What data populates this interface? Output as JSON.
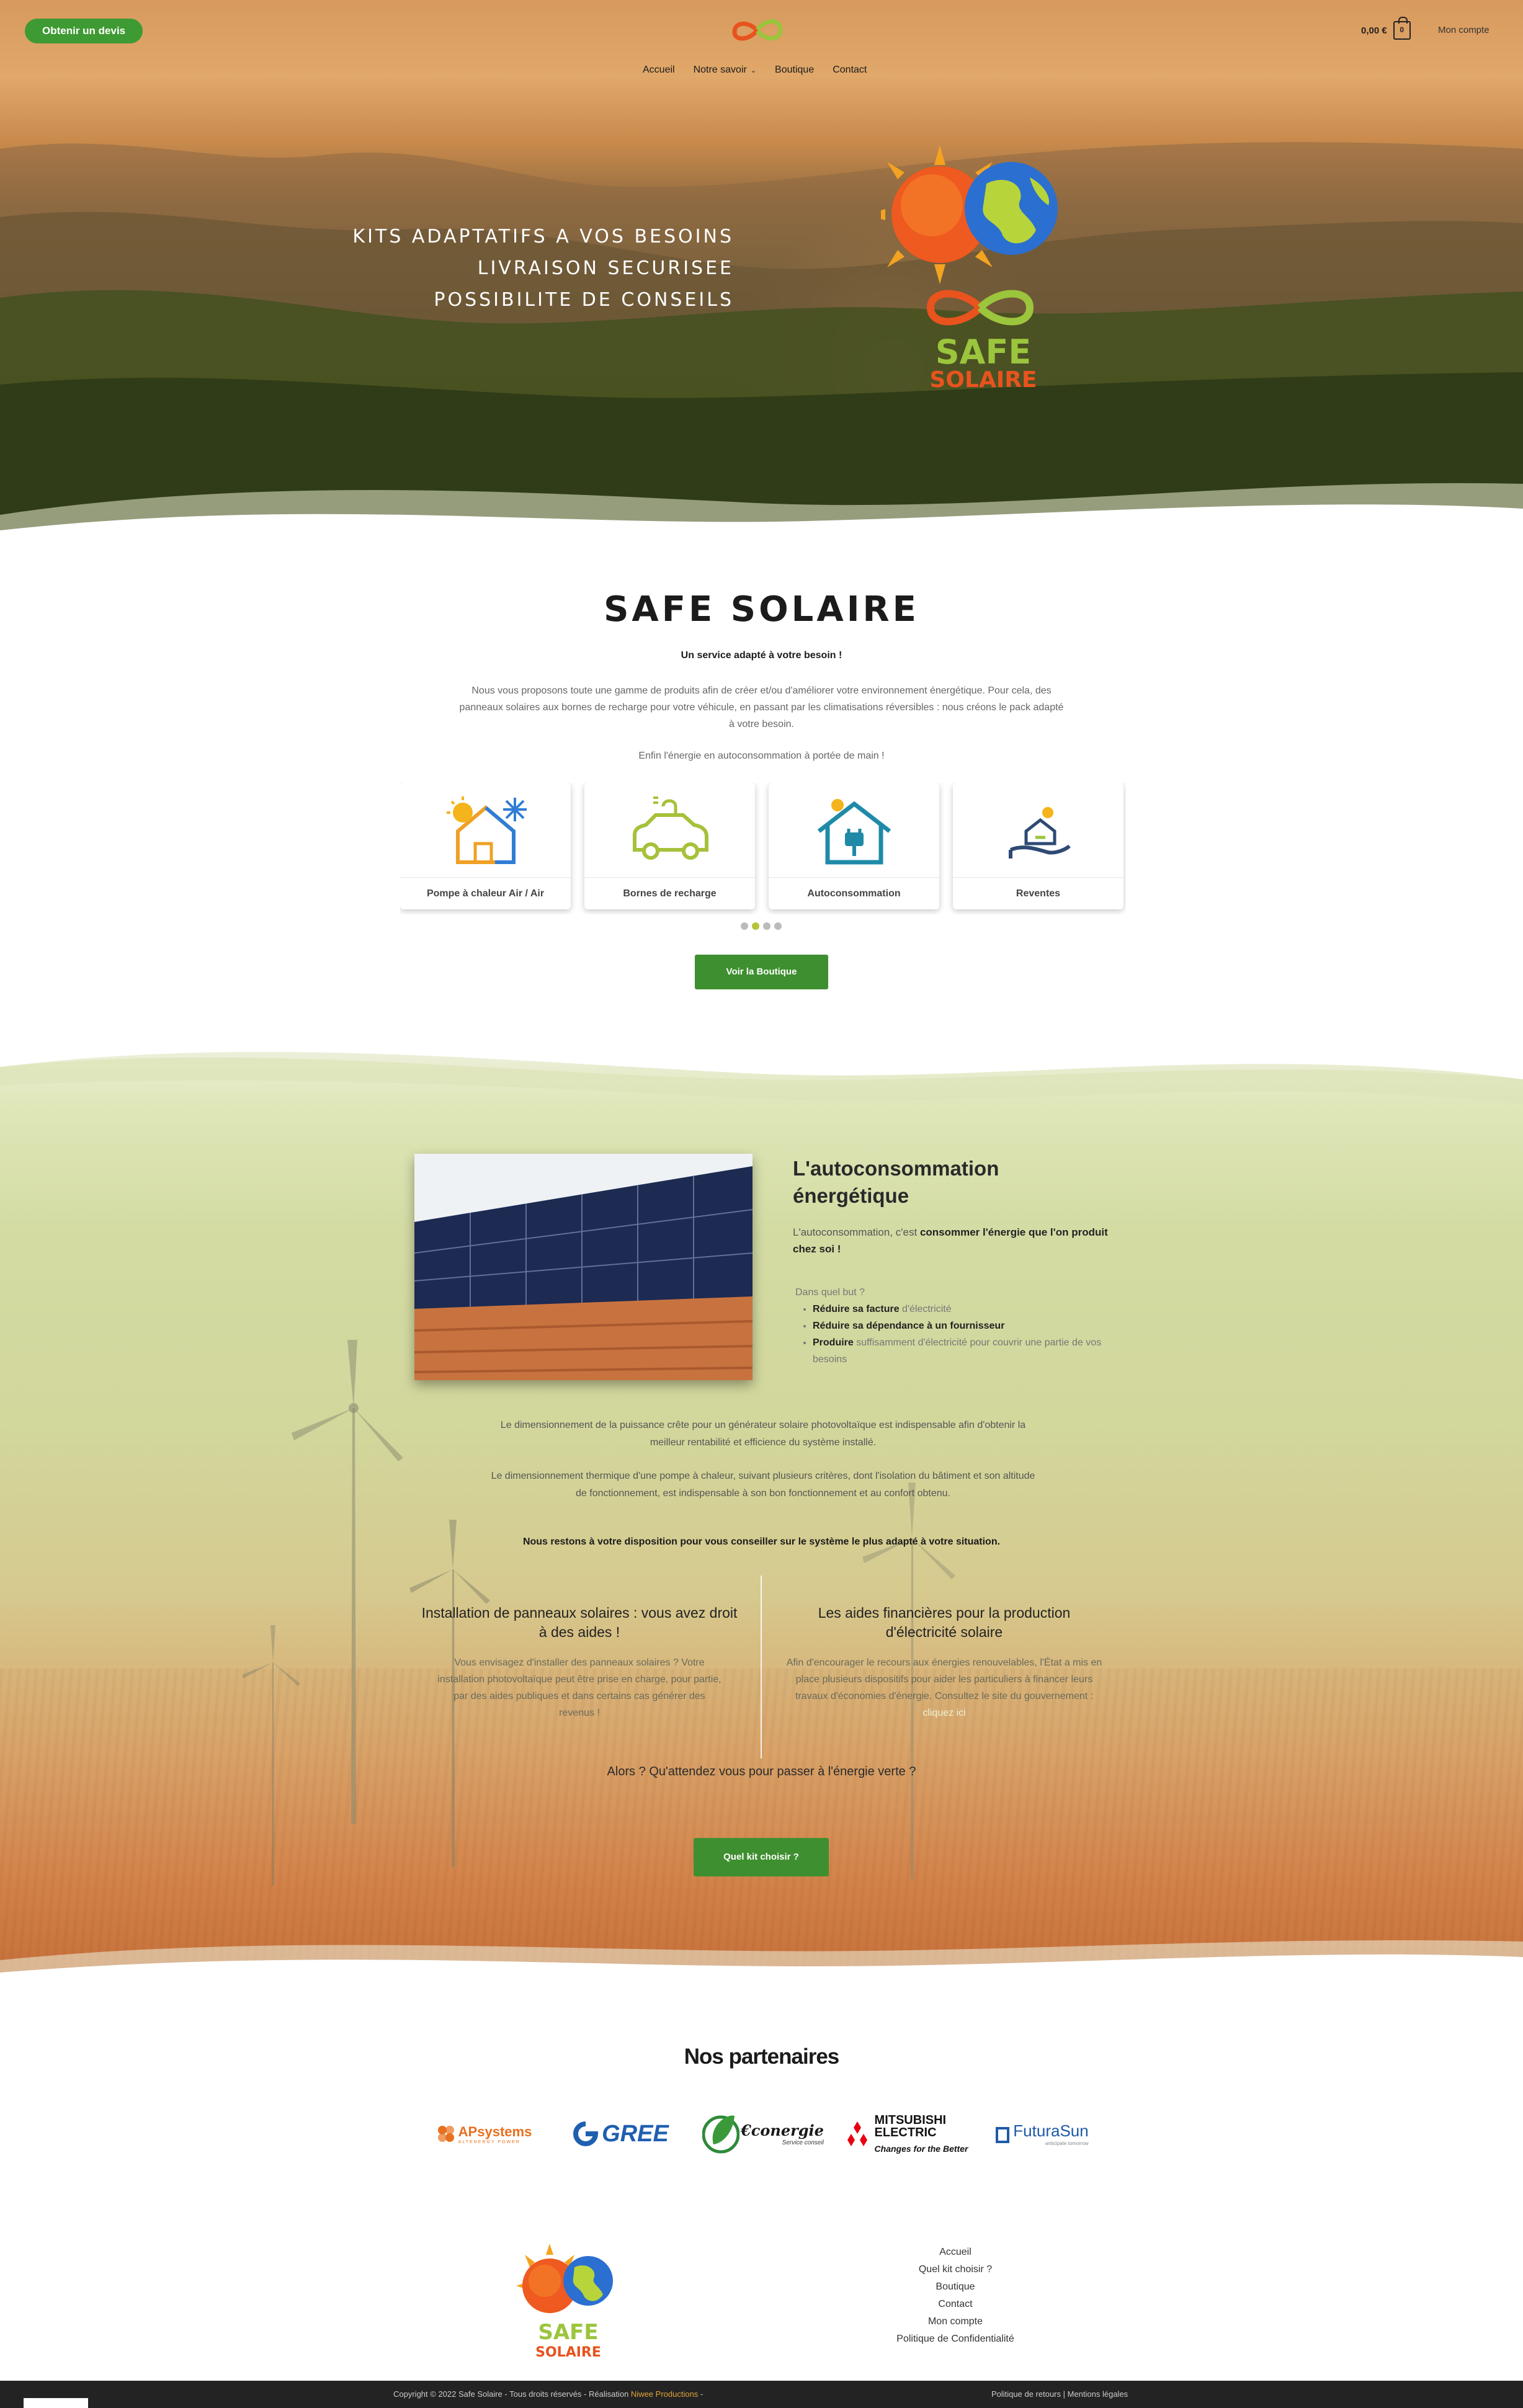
{
  "header": {
    "quote_button": "Obtenir un devis",
    "nav": [
      "Accueil",
      "Notre savoir",
      "Boutique",
      "Contact"
    ],
    "cart_total": "0,00 €",
    "cart_count": "0",
    "account": "Mon compte"
  },
  "hero": {
    "line1": "Kits adaptatifs a vos besoins",
    "line2": "Livraison securisee",
    "line3": "Possibilite de conseils",
    "logo_text_1": "SAFE",
    "logo_text_2": "SOLAIRE"
  },
  "intro": {
    "title": "SAFE SOLAIRE",
    "subtitle": "Un service adapté à votre besoin !",
    "paragraph": "Nous vous proposons toute une gamme de produits afin de créer et/ou d'améliorer votre environnement énergétique. Pour cela, des panneaux solaires aux bornes de recharge pour votre véhicule, en passant par les climatisations réversibles : nous créons le pack adapté à votre besoin.",
    "paragraph2": "Enfin l'énergie en autoconsommation à portée de main !",
    "cards": [
      {
        "label": "Pompe à chaleur Air / Air",
        "icon": "heat-pump-icon"
      },
      {
        "label": "Bornes de recharge",
        "icon": "ev-car-icon"
      },
      {
        "label": "Autoconsommation",
        "icon": "house-plug-icon"
      },
      {
        "label": "Reventes",
        "icon": "hand-house-icon"
      }
    ],
    "carousel_active": 2,
    "shop_button": "Voir la Boutique"
  },
  "autoconsommation": {
    "title_line1": "L'autoconsommation",
    "title_line2": "énergétique",
    "lead_plain": "L'autoconsommation, c'est ",
    "lead_bold": "consommer l'énergie que l'on produit chez soi !",
    "why": "Dans quel but ?",
    "bullets": [
      {
        "bold": "Réduire sa facture",
        "rest": " d'électricité"
      },
      {
        "bold": "Réduire sa dépendance à un fournisseur",
        "rest": ""
      },
      {
        "bold": "Produire",
        "rest": " suffisamment d'électricité pour couvrir une partie de vos besoins"
      }
    ],
    "dim1": "Le dimensionnement de la puissance crête pour un générateur solaire photovoltaïque est indispensable afin d'obtenir la meilleur rentabilité et efficience du système installé.",
    "dim2": "Le dimensionnement thermique d'une pompe à chaleur, suivant plusieurs critères, dont l'isolation du bâtiment et son altitude de fonctionnement, est indispensable à son bon fonctionnement et au confort obtenu.",
    "dim_bold": "Nous restons à votre disposition pour vous conseiller sur le système le plus adapté à votre situation.",
    "col_left_title": "Installation de panneaux solaires : vous avez droit à des aides !",
    "col_left_text": "Vous envisagez d'installer des panneaux solaires ? Votre installation photovoltaïque peut être prise en charge, pour partie, par des aides publiques et dans certains cas générer des revenus !",
    "col_right_title": "Les aides financières pour la production d'électricité solaire",
    "col_right_text": "Afin d'encourager le recours aux énergies renouvelables, l'État a mis en place plusieurs dispositifs pour aider les particuliers à financer leurs travaux d'économies d'énergie. Consultez le site du gouvernement :",
    "col_right_link": "cliquez ici",
    "alors": "Alors ? Qu'attendez vous pour passer à l'énergie verte ?",
    "kit_button": "Quel kit choisir ?"
  },
  "partners": {
    "title": "Nos partenaires",
    "logos": [
      {
        "main": "APsystems",
        "sub": "ALTENERGY POWER",
        "color": "#e8701e"
      },
      {
        "main": "GREE",
        "color": "#1e5fb0"
      },
      {
        "main": "€conergie",
        "sub": "Service conseil",
        "color": "#1a1a1a"
      },
      {
        "main": "MITSUBISHI",
        "main2": "ELECTRIC",
        "sub": "Changes for the Better",
        "color": "#e60012"
      },
      {
        "main": "FuturaSun",
        "sub": "anticipate tomorrow",
        "color": "#1e5aa8"
      }
    ]
  },
  "footer": {
    "logo_text_1": "SAFE",
    "logo_text_2": "SOLAIRE",
    "links": [
      "Accueil",
      "Quel kit choisir ?",
      "Boutique",
      "Contact",
      "Mon compte",
      "Politique de Confidentialité"
    ],
    "copyright": "Copyright © 2022 Safe Solaire - Tous droits réservés - Réalisation ",
    "author": "Niwee Productions",
    "copyright_tail": " -",
    "legal": "Politique de retours | Mentions légales"
  },
  "colors": {
    "accent_green": "#3e8f2f",
    "carousel_active": "#b7c23a",
    "logo_orange": "#e8531e",
    "logo_green": "#9bc53d"
  }
}
